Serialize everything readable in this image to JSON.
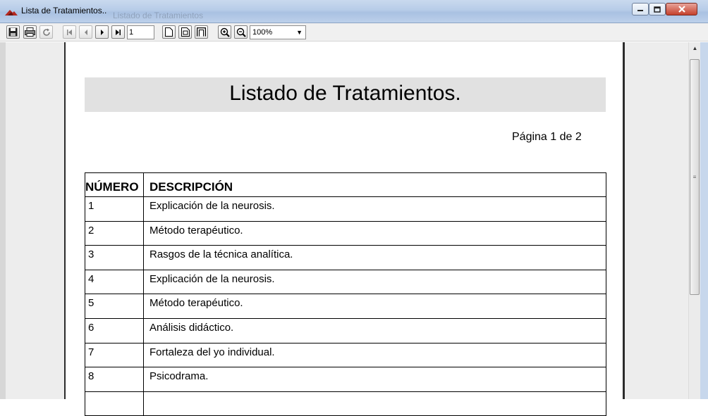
{
  "window": {
    "title": "Lista de Tratamientos..",
    "background_title": "Listado de Tratamientos"
  },
  "toolbar": {
    "page_value": "1",
    "zoom_value": "100%"
  },
  "report": {
    "title": "Listado de Tratamientos.",
    "page_label": "Página 1 de 2",
    "headers": {
      "number": "NÚMERO",
      "description": "DESCRIPCIÓN"
    },
    "rows": [
      {
        "number": "1",
        "description": "Explicación de la neurosis."
      },
      {
        "number": "2",
        "description": "Método terapéutico."
      },
      {
        "number": "3",
        "description": "Rasgos de la técnica analítica."
      },
      {
        "number": "4",
        "description": "Explicación de la neurosis."
      },
      {
        "number": "5",
        "description": "Método terapéutico."
      },
      {
        "number": "6",
        "description": "Análisis didáctico."
      },
      {
        "number": "7",
        "description": "Fortaleza del yo  individual."
      },
      {
        "number": "8",
        "description": "Psicodrama."
      }
    ]
  },
  "icons": {
    "app": "app-logo-icon",
    "save": "save-icon",
    "print": "print-icon",
    "refresh": "refresh-icon",
    "first": "first-page-icon",
    "prev": "prev-page-icon",
    "next": "next-page-icon",
    "last": "last-page-icon",
    "page_single": "single-page-icon",
    "page_width": "page-width-icon",
    "page_full": "full-page-icon",
    "zoom_in": "zoom-in-icon",
    "zoom_out": "zoom-out-icon"
  }
}
